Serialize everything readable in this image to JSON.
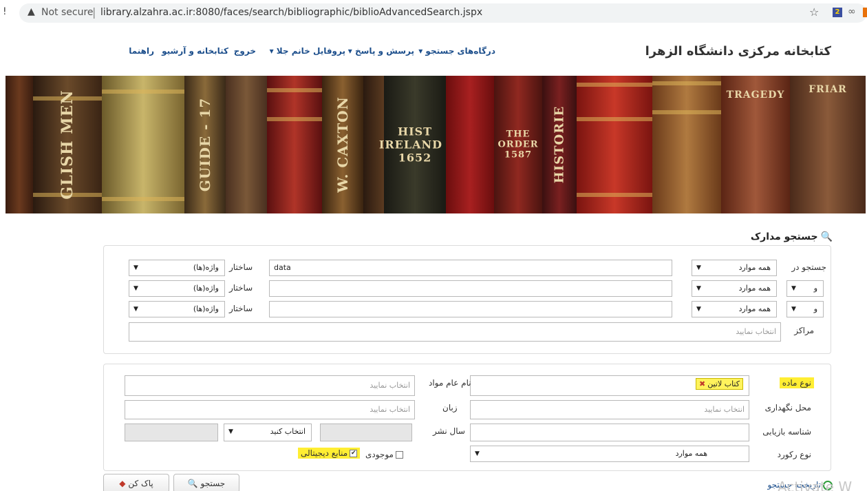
{
  "browser": {
    "left_mark": "!",
    "security_label": "Not secure",
    "url": "library.alzahra.ac.ir:8080/faces/search/bibliographic/biblioAdvancedSearch.jspx"
  },
  "header": {
    "site_title": "کتابخانه مرکزی دانشگاه الزهرا",
    "nav": [
      {
        "label": "درگاه‌های جستجو ▾"
      },
      {
        "label": "پرسش و پاسخ ▾"
      },
      {
        "label": "پروفایل خانم جلا ▾"
      },
      {
        "label": "خروج"
      },
      {
        "label": "کتابخانه و آرشیو"
      },
      {
        "label": "راهنما"
      }
    ]
  },
  "banner": {
    "spines": [
      "GLISH MEN",
      "GUIDE - 17",
      "W. CAXTON",
      "HIST IRELAND 1652",
      "THE ORDER 1587",
      "HISTORIE",
      "TRAGEDY",
      "FRIAR"
    ]
  },
  "search": {
    "title": "جستجو مدارک",
    "search_in_label": "جستجو در",
    "rows": [
      {
        "conj": "",
        "field": "همه موارد",
        "query": "data",
        "structure_label": "ساختار",
        "structure": "واژه(ها)"
      },
      {
        "conj": "و",
        "field": "همه موارد",
        "query": "",
        "structure_label": "ساختار",
        "structure": "واژه(ها)"
      },
      {
        "conj": "و",
        "field": "همه موارد",
        "query": "",
        "structure_label": "ساختار",
        "structure": "واژه(ها)"
      }
    ],
    "centers_label": "مراکز",
    "centers_placeholder": "انتخاب نمایید"
  },
  "filters": {
    "material_type_label": "نوع ماده",
    "material_type_chip": "کتاب لاتین",
    "general_material_label": "نام عام مواد",
    "general_material_placeholder": "انتخاب نمایید",
    "location_label": "محل نگهداری",
    "location_placeholder": "انتخاب نمایید",
    "language_label": "زبان",
    "language_placeholder": "انتخاب نمایید",
    "retrieval_id_label": "شناسه بازیابی",
    "pub_year_label": "سال نشر",
    "pub_year_select": "انتخاب کنید",
    "record_type_label": "نوع رکورد",
    "record_type_value": "همه موارد",
    "available_label": "موجودی",
    "available_checked": false,
    "digital_label": "منابع دیجیتالی",
    "digital_checked": true
  },
  "actions": {
    "search_button": "جستجو",
    "clear_button": "پاک کن",
    "history_link": "تاریخچه جستجو"
  },
  "watermark": "Activate W",
  "colors": {
    "nav_blue": "#1d4f8c",
    "highlight": "#ffee33"
  }
}
